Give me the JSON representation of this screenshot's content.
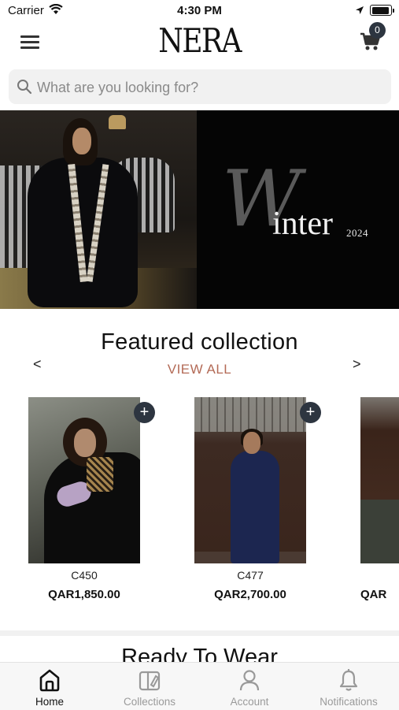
{
  "status_bar": {
    "carrier": "Carrier",
    "time": "4:30 PM"
  },
  "header": {
    "logo": "NERA",
    "cart_count": "0"
  },
  "search": {
    "placeholder": "What are you looking for?"
  },
  "banner": {
    "initial": "W",
    "text": "inter",
    "year": "2024"
  },
  "featured": {
    "title": "Featured collection",
    "view_all": "VIEW ALL",
    "prev": "<",
    "next": ">",
    "products": [
      {
        "code": "C450",
        "price": "QAR1,850.00"
      },
      {
        "code": "C477",
        "price": "QAR2,700.00"
      },
      {
        "code": "",
        "price": "QAR"
      }
    ]
  },
  "ready_to_wear": {
    "title": "Ready To Wear"
  },
  "tabs": [
    {
      "label": "Home",
      "icon": "home-icon"
    },
    {
      "label": "Collections",
      "icon": "collections-icon"
    },
    {
      "label": "Account",
      "icon": "account-icon"
    },
    {
      "label": "Notifications",
      "icon": "bell-icon"
    }
  ],
  "colors": {
    "accent": "#b36a56",
    "badge": "#2d3540",
    "active_tab": "#111111",
    "inactive_tab": "#9a9a9a"
  }
}
